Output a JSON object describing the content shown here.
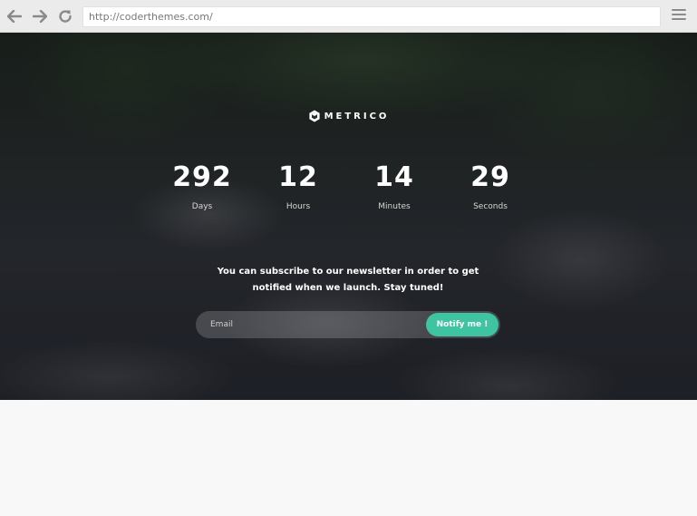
{
  "browser": {
    "url": "http://coderthemes.com/",
    "back_icon": "arrow-left-icon",
    "forward_icon": "arrow-right-icon",
    "reload_icon": "reload-icon",
    "menu_icon": "hamburger-menu-icon"
  },
  "brand": {
    "name": "METRICO",
    "logo_icon": "hexagon-logo-icon"
  },
  "countdown": [
    {
      "value": "292",
      "label": "Days"
    },
    {
      "value": "12",
      "label": "Hours"
    },
    {
      "value": "14",
      "label": "Minutes"
    },
    {
      "value": "29",
      "label": "Seconds"
    }
  ],
  "newsletter": {
    "text": "You can subscribe to our newsletter in order to get notified when we launch. Stay tuned!",
    "email_placeholder": "Email",
    "button_label": "Notify me !"
  },
  "colors": {
    "accent": "#3ec4a0",
    "chrome": "#ebebeb",
    "page_bg": "#f8f8f8"
  }
}
